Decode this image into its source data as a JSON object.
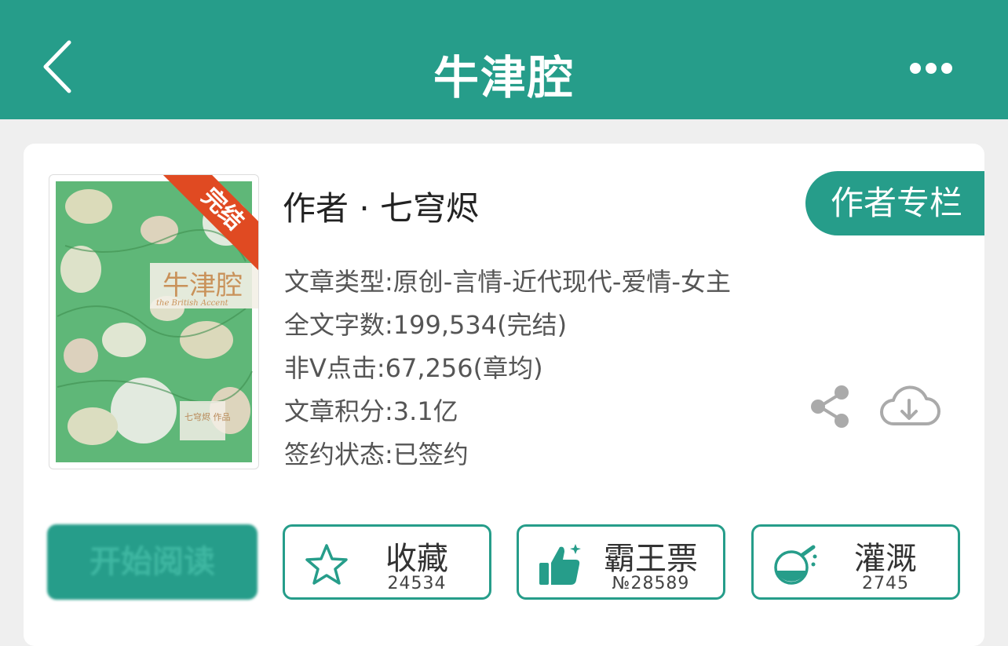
{
  "header": {
    "title": "牛津腔",
    "back_icon": "chevron-left-icon",
    "more_icon": "more-dots-icon"
  },
  "book": {
    "cover_title": "牛津腔",
    "cover_subtitle": "the British Accent",
    "cover_author_tag": "七穹烬 作品",
    "status_badge": "完结",
    "author": "作者 · 七穹烬",
    "author_column_label": "作者专栏",
    "info": {
      "type": "文章类型:原创-言情-近代现代-爱情-女主",
      "word_count": "全文字数:199,534(完结)",
      "clicks": "非V点击:67,256(章均)",
      "score": "文章积分:3.1亿",
      "sign_status": "签约状态:已签约"
    }
  },
  "actions": {
    "start_reading": "开始阅读",
    "favorite": {
      "label": "收藏",
      "count": "24534",
      "icon": "star-icon"
    },
    "ticket": {
      "label": "霸王票",
      "count": "№28589",
      "icon": "thumbs-up-icon"
    },
    "nutrient": {
      "label": "灌溉",
      "count": "2745",
      "icon": "flask-icon"
    }
  },
  "colors": {
    "brand": "#269d8a",
    "badge": "#e04a22",
    "background": "#efefef"
  }
}
